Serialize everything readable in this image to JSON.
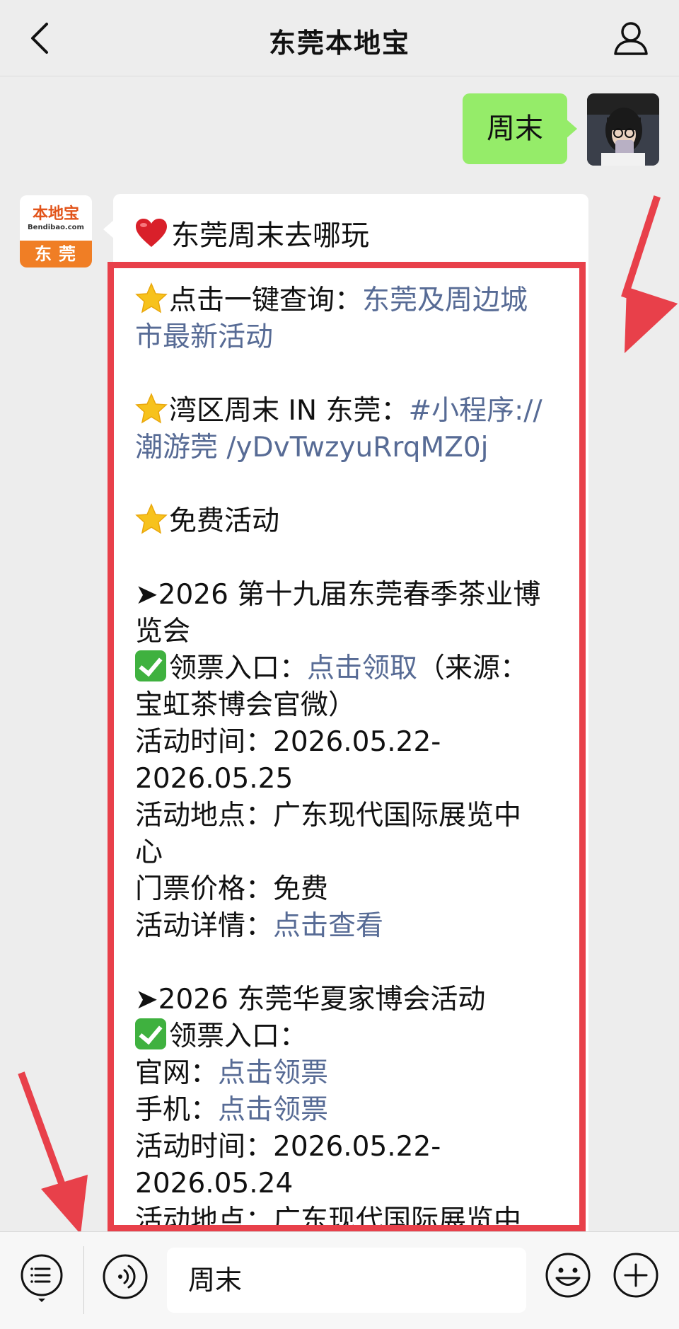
{
  "header": {
    "title": "东莞本地宝",
    "back_icon": "chevron-left-icon",
    "profile_icon": "user-icon"
  },
  "user_message": {
    "text": "周末"
  },
  "bot": {
    "avatar_logo_text": "本地宝",
    "avatar_logo_sub": "Bendibao.com",
    "avatar_city": "东莞"
  },
  "reply": {
    "title": "东莞周末去哪玩",
    "section1_label": "点击一键查询：",
    "section1_link_a": "东莞及周边城",
    "section1_link_b": "市最新活动",
    "section2_label": "湾区周末 IN 东莞：",
    "section2_link_a": "#小程序://",
    "section2_link_b": "潮游莞 /yDvTwzyuRrqMZ0j",
    "section3_label": "免费活动",
    "event1": {
      "title_a": "➤2026 第十九届东莞春季茶业博",
      "title_b": "览会",
      "ticket_label": "领票入口：",
      "ticket_link": "点击领取",
      "ticket_source_a": "（来源：",
      "ticket_source_b": "宝虹茶博会官微）",
      "time_a": "活动时间：2026.05.22-",
      "time_b": "2026.05.25",
      "place_a": "活动地点：广东现代国际展览中",
      "place_b": "心",
      "price": "门票价格：免费",
      "detail_label": "活动详情：",
      "detail_link": "点击查看"
    },
    "event2": {
      "title": "➤2026 东莞华夏家博会活动",
      "ticket_label": "领票入口：",
      "web_label": "官网：",
      "web_link": "点击领票",
      "mobile_label": "手机：",
      "mobile_link": "点击领票",
      "time_a": "活动时间：2026.05.22-",
      "time_b": "2026.05.24",
      "place_a": "活动地点：广东现代国际展览中"
    }
  },
  "input_bar": {
    "menu_icon": "list-menu-icon",
    "voice_icon": "voice-icon",
    "text_value": "周末",
    "emoji_icon": "emoji-icon",
    "plus_icon": "plus-circle-icon"
  },
  "colors": {
    "link": "#576b95",
    "bubble_green": "#95ec69",
    "highlight_red": "#e8404a",
    "brand_orange": "#f07e25"
  }
}
